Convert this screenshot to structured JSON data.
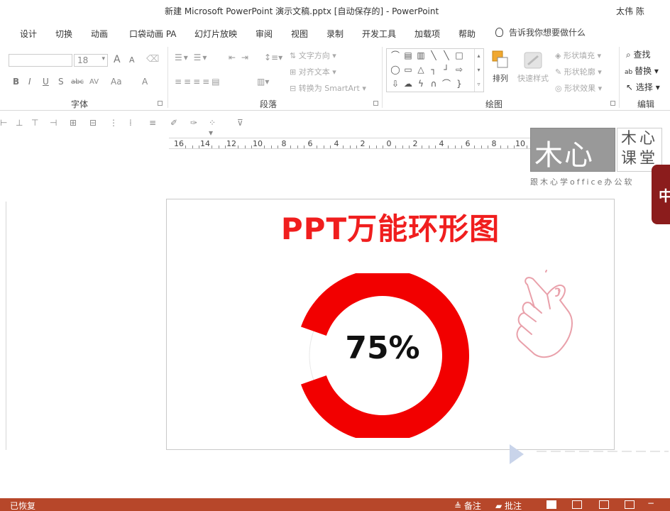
{
  "window": {
    "title": "新建 Microsoft PowerPoint 演示文稿.pptx [自动保存的]  -  PowerPoint",
    "user": "太伟 陈"
  },
  "menu": {
    "tabs": [
      "设计",
      "切换",
      "动画",
      "口袋动画 PA",
      "幻灯片放映",
      "审阅",
      "视图",
      "录制",
      "开发工具",
      "加载项",
      "帮助"
    ],
    "tell_me": "告诉我你想要做什么"
  },
  "ribbon": {
    "font_group": {
      "label": "字体",
      "font_size": "18",
      "grow": "A",
      "shrink": "A",
      "bold": "B",
      "italic": "I",
      "underline": "U",
      "shadow": "S",
      "strike": "abc",
      "spacing": "AV",
      "case": "Aa",
      "color": "A"
    },
    "paragraph_group": {
      "label": "段落",
      "text_direction": "文字方向",
      "align_text": "对齐文本",
      "convert_smartart": "转换为 SmartArt"
    },
    "drawing_group": {
      "label": "绘图",
      "arrange": "排列",
      "quick_styles": "快速样式",
      "shape_fill": "形状填充",
      "shape_outline": "形状轮廓",
      "shape_effects": "形状效果"
    },
    "editing_group": {
      "label": "编辑",
      "find": "查找",
      "replace": "替换",
      "select": "选择"
    }
  },
  "ruler": {
    "marks": [
      "16",
      "14",
      "12",
      "10",
      "8",
      "6",
      "4",
      "2",
      "0",
      "2",
      "4",
      "6",
      "8",
      "10"
    ]
  },
  "watermark": {
    "logo": "木心",
    "brand": "木心课堂",
    "subtitle": "跟木心学office办公软"
  },
  "side_tab": "中",
  "slide": {
    "title": "PPT万能环形图",
    "percent_label": "75%",
    "ring_fill_fraction": 0.75,
    "ring_color": "#f20000"
  },
  "status": {
    "left": "已恢复",
    "notes": "备注",
    "comments": "批注"
  },
  "colors": {
    "accent": "#b7472a",
    "title_red": "#f01e1e"
  }
}
